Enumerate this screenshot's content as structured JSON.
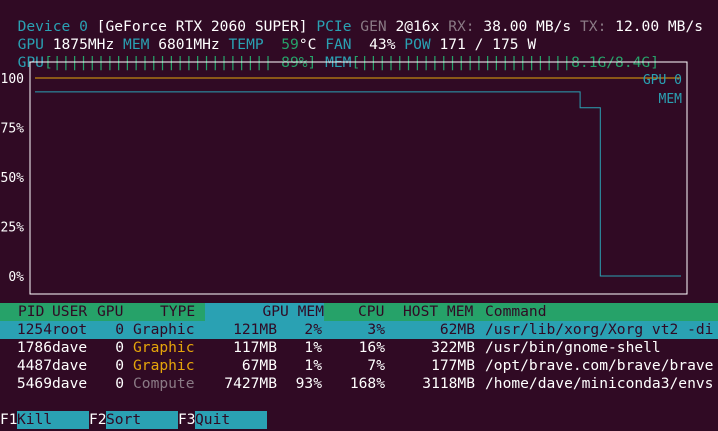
{
  "status": {
    "device_label": "Device 0",
    "device_name": "[GeForce RTX 2060 SUPER]",
    "pcie_label": "PCIe",
    "gen_label": "GEN",
    "gen_value": "2@16x",
    "rx_label": "RX:",
    "rx_value": "38.00 MB/s",
    "tx_label": "TX:",
    "tx_value": "12.00 MB/s",
    "gpu_label": "GPU",
    "gpu_clock": "1875MHz",
    "mem_label": "MEM",
    "mem_clock": "6801MHz",
    "temp_label": "TEMP",
    "temp_value": "59",
    "temp_unit": "°C",
    "fan_label": "FAN",
    "fan_value": "43%",
    "pow_label": "POW",
    "pow_value": "171 / 175 W"
  },
  "bars": {
    "gpu_label": "GPU",
    "gpu_bar": "[||||||||||||||||||||||||| 89%]",
    "gpu_percent": 89,
    "mem_label": "MEM",
    "mem_bar": "[||||||||||||||||||||||||8.1G/8.4G]",
    "mem_used": "8.1G",
    "mem_total": "8.4G"
  },
  "chart_data": {
    "type": "line",
    "yticks": [
      "100",
      "75%",
      "50%",
      "25%",
      "0%"
    ],
    "ylim": [
      0,
      100
    ],
    "legend": "top-right",
    "series": [
      {
        "name": "GPU 0",
        "color": "#e5a50a",
        "values": [
          100,
          100,
          100,
          100,
          100,
          100,
          100,
          100,
          100,
          100,
          100,
          100,
          100,
          100,
          100,
          100,
          100,
          100,
          100,
          100,
          100,
          100,
          100,
          100,
          100,
          100,
          100,
          100,
          100,
          100,
          100,
          100
        ]
      },
      {
        "name": "MEM",
        "color": "#2aa1b3",
        "values": [
          93,
          93,
          93,
          93,
          93,
          93,
          93,
          93,
          93,
          93,
          93,
          93,
          93,
          93,
          93,
          93,
          93,
          93,
          93,
          93,
          93,
          93,
          93,
          93,
          93,
          93,
          93,
          85,
          0,
          0,
          0,
          0
        ]
      }
    ]
  },
  "table": {
    "headers": {
      "pid": "PID",
      "user": "USER",
      "gpu": "GPU",
      "type": "TYPE",
      "gpu_mem": "GPU MEM",
      "cpu": "CPU",
      "host_mem": "HOST MEM",
      "command": "Command"
    },
    "rows": [
      {
        "pid": "1254",
        "user": "root",
        "gpu": "0",
        "type": "Graphic",
        "gpu_mem": "121MB",
        "gpu_mem_pct": "2%",
        "cpu": "3%",
        "host_mem": "62MB",
        "command": "/usr/lib/xorg/Xorg vt2 -di"
      },
      {
        "pid": "1786",
        "user": "dave",
        "gpu": "0",
        "type": "Graphic",
        "gpu_mem": "117MB",
        "gpu_mem_pct": "1%",
        "cpu": "16%",
        "host_mem": "322MB",
        "command": "/usr/bin/gnome-shell"
      },
      {
        "pid": "4487",
        "user": "dave",
        "gpu": "0",
        "type": "Graphic",
        "gpu_mem": "67MB",
        "gpu_mem_pct": "1%",
        "cpu": "7%",
        "host_mem": "177MB",
        "command": "/opt/brave.com/brave/brave"
      },
      {
        "pid": "5469",
        "user": "dave",
        "gpu": "0",
        "type": "Compute",
        "gpu_mem": "7427MB",
        "gpu_mem_pct": "93%",
        "cpu": "168%",
        "host_mem": "3118MB",
        "command": "/home/dave/miniconda3/envs"
      }
    ]
  },
  "footer": [
    {
      "key": "F1",
      "label": "Kill"
    },
    {
      "key": "F2",
      "label": "Sort"
    },
    {
      "key": "F3",
      "label": "Quit"
    }
  ],
  "colors": {
    "background": "#300a24",
    "accent_cyan": "#2aa1b3",
    "header_green": "#26a269",
    "graphic_orange": "#e5a50a",
    "compute_gray": "#8a7a85"
  }
}
